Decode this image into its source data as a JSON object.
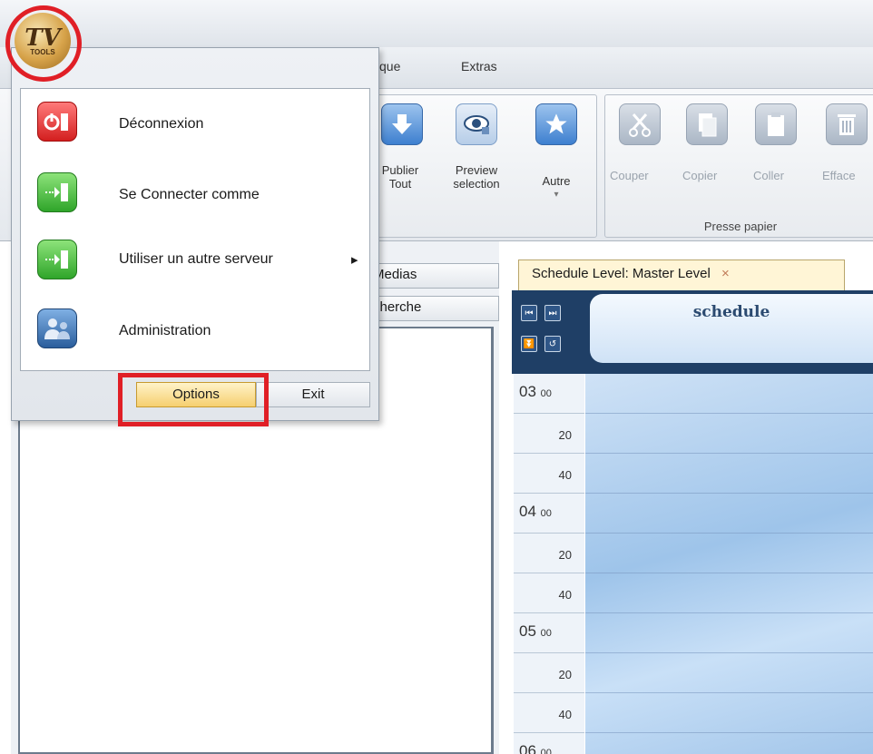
{
  "app": {
    "logo_text": "TV",
    "logo_subtext": "TOOLS"
  },
  "menubar": {
    "items": [
      "que",
      "Extras"
    ]
  },
  "ribbon": {
    "publish_group": {
      "publish_all_label_1": "Publier",
      "publish_all_label_2": "Tout",
      "preview_label_1": "Preview",
      "preview_label_2": "selection",
      "other_label": "Autre",
      "other_arrow": "▾"
    },
    "clipboard_group": {
      "label": "Presse papier",
      "cut": "Couper",
      "copy": "Copier",
      "paste": "Coller",
      "delete": "Efface"
    }
  },
  "left_panel": {
    "tabs": [
      "Medias",
      "cherche"
    ]
  },
  "schedule": {
    "tab_label": "Schedule Level: Master Level",
    "tab_close": "×",
    "title": "schedule",
    "nav": [
      "⏮",
      "⏭",
      "⏬",
      "↺"
    ],
    "times": [
      {
        "hour": "03",
        "min": "00",
        "is_hour": true
      },
      {
        "label": "20",
        "is_hour": false
      },
      {
        "label": "40",
        "is_hour": false
      },
      {
        "hour": "04",
        "min": "00",
        "is_hour": true
      },
      {
        "label": "20",
        "is_hour": false
      },
      {
        "label": "40",
        "is_hour": false
      },
      {
        "hour": "05",
        "min": "00",
        "is_hour": true
      },
      {
        "label": "20",
        "is_hour": false
      },
      {
        "label": "40",
        "is_hour": false
      },
      {
        "hour": "06",
        "min": "00",
        "is_hour": true
      }
    ]
  },
  "app_menu": {
    "items": [
      {
        "label": "Déconnexion",
        "icon": "power-icon",
        "color": "#d31f1f"
      },
      {
        "label": "Se Connecter comme",
        "icon": "login-icon",
        "color": "#2fa52a"
      },
      {
        "label": "Utiliser un autre serveur",
        "icon": "server-switch-icon",
        "color": "#2fa52a",
        "submenu_arrow": "▸"
      },
      {
        "label": "Administration",
        "icon": "users-icon",
        "color": "#2a5d9c"
      }
    ],
    "options_label": "Options",
    "exit_label": "Exit"
  },
  "colors": {
    "highlight": "#e01f26",
    "schedule_header": "#1f3f66"
  }
}
